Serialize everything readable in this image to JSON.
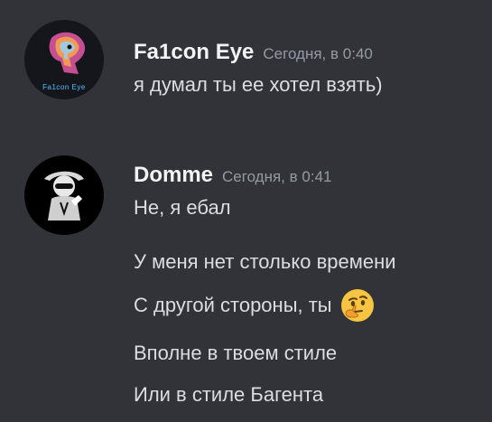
{
  "colors": {
    "background": "#313338",
    "username": "#f2f3f5",
    "message_text": "#dbdee1",
    "timestamp": "#949ba4"
  },
  "messages": [
    {
      "avatar_icon": "falcon-eye-avatar",
      "avatar_text": "Fa1con Eye",
      "username": "Fa1con Eye",
      "timestamp": "Сегодня, в 0:40",
      "lines": [
        "я думал ты ее хотел взять)"
      ]
    },
    {
      "avatar_icon": "domme-avatar",
      "username": "Domme",
      "timestamp": "Сегодня, в 0:41",
      "lines": [
        "Не, я ебал",
        "У меня нет столько времени",
        "С другой стороны, ты",
        "Вполне в твоем стиле",
        "Или в стиле Багента"
      ],
      "emoji_icon": "thinking-face-icon"
    }
  ]
}
